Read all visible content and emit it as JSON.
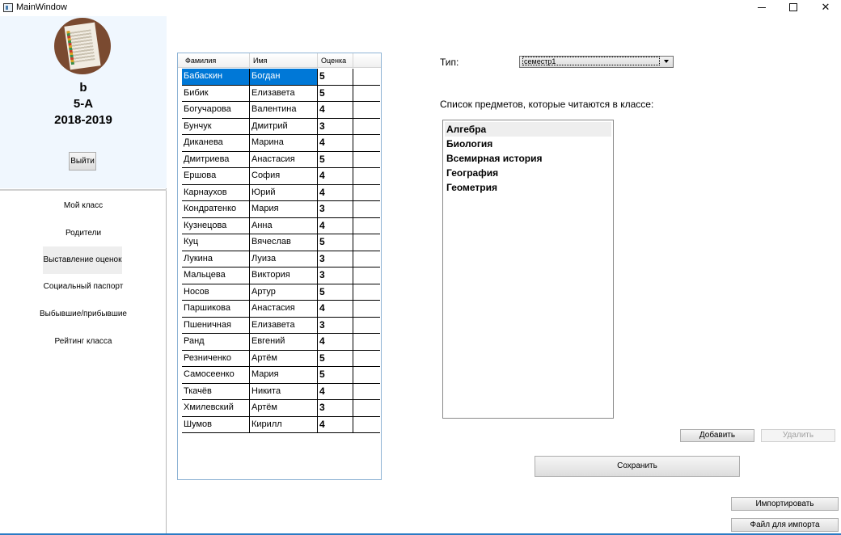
{
  "window": {
    "title": "MainWindow"
  },
  "profile": {
    "name": "b",
    "class": "5-А",
    "year": "2018-2019",
    "logout_label": "Выйти"
  },
  "nav": {
    "items": [
      {
        "label": "Мой класс"
      },
      {
        "label": "Родители"
      },
      {
        "label": "Выставление оценок"
      },
      {
        "label": "Социальный паспорт"
      },
      {
        "label": "Выбывшие/прибывшие"
      },
      {
        "label": "Рейтинг класса"
      }
    ],
    "active_index": 2
  },
  "grades_table": {
    "columns": [
      "Фамилия",
      "Имя",
      "Оценка"
    ],
    "selected_row": 0,
    "rows": [
      {
        "surname": "Бабаскин",
        "name": "Богдан",
        "grade": "5"
      },
      {
        "surname": "Бибик",
        "name": "Елизавета",
        "grade": "5"
      },
      {
        "surname": "Богучарова",
        "name": "Валентина",
        "grade": "4"
      },
      {
        "surname": "Бунчук",
        "name": "Дмитрий",
        "grade": "3"
      },
      {
        "surname": "Диканева",
        "name": "Марина",
        "grade": "4"
      },
      {
        "surname": "Дмитриева",
        "name": "Анастасия",
        "grade": "5"
      },
      {
        "surname": "Ершова",
        "name": "София",
        "grade": "4"
      },
      {
        "surname": "Карнаухов",
        "name": "Юрий",
        "grade": "4"
      },
      {
        "surname": "Кондратенко",
        "name": "Мария",
        "grade": "3"
      },
      {
        "surname": "Кузнецова",
        "name": "Анна",
        "grade": "4"
      },
      {
        "surname": "Куц",
        "name": "Вячеслав",
        "grade": "5"
      },
      {
        "surname": "Лукина",
        "name": "Луиза",
        "grade": "3"
      },
      {
        "surname": "Мальцева",
        "name": "Виктория",
        "grade": "3"
      },
      {
        "surname": "Носов",
        "name": "Артур",
        "grade": "5"
      },
      {
        "surname": "Паршикова",
        "name": "Анастасия",
        "grade": "4"
      },
      {
        "surname": "Пшеничная",
        "name": "Елизавета",
        "grade": "3"
      },
      {
        "surname": "Ранд",
        "name": "Евгений",
        "grade": "4"
      },
      {
        "surname": "Резниченко",
        "name": "Артём",
        "grade": "5"
      },
      {
        "surname": "Самосеенко",
        "name": "Мария",
        "grade": "5"
      },
      {
        "surname": "Ткачёв",
        "name": "Никита",
        "grade": "4"
      },
      {
        "surname": "Хмилевский",
        "name": "Артём",
        "grade": "3"
      },
      {
        "surname": "Шумов",
        "name": "Кирилл",
        "grade": "4"
      }
    ]
  },
  "type_field": {
    "label": "Тип:",
    "value": "семестр1"
  },
  "subjects": {
    "label": "Список предметов, которые читаются в классе:",
    "items": [
      "Алгебра",
      "Биология",
      "Всемирная история",
      "География",
      "Геометрия"
    ],
    "highlighted_index": 0
  },
  "buttons": {
    "add": "Добавить",
    "delete": "Удалить",
    "save": "Сохранить",
    "import": "Импортировать",
    "import_file": "Файл для импорта"
  },
  "colors": {
    "selection": "#0078d7",
    "profile_bg": "#f0f7fe",
    "grid_border": "#8fb4d5"
  },
  "icons": {
    "app": "window-icon",
    "minimize": "minimize-icon",
    "maximize": "maximize-icon",
    "close": "close-icon"
  }
}
